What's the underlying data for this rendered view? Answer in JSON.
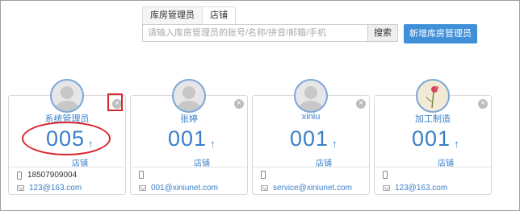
{
  "tabs": [
    {
      "label": "库房管理员",
      "active": false
    },
    {
      "label": "店铺",
      "active": true
    }
  ],
  "search": {
    "placeholder": "请输入库房管理员的账号/名称/拼音/邮箱/手机",
    "button_label": "搜索"
  },
  "add_button_label": "新增库房管理员",
  "cards": [
    {
      "name": "系统管理员",
      "count": "005",
      "arrow": "↑",
      "unit": "店铺",
      "phone": "18507909004",
      "email": "123@163.com",
      "avatar": "default-avatar-icon"
    },
    {
      "name": "张婷",
      "count": "001",
      "arrow": "↑",
      "unit": "店铺",
      "phone": "",
      "email": "001@xiniunet.com",
      "avatar": "default-avatar-icon"
    },
    {
      "name": "xiniu",
      "count": "001",
      "arrow": "↑",
      "unit": "店铺",
      "phone": "",
      "email": "service@xiniunet.com",
      "avatar": "default-avatar-icon"
    },
    {
      "name": "加工制造",
      "count": "001",
      "arrow": "↑",
      "unit": "店铺",
      "phone": "",
      "email": "123@163.com",
      "avatar": "flower-avatar-icon"
    }
  ],
  "close_icon": "×",
  "colors": {
    "accent": "#3a7fc6",
    "button": "#3f8fd9",
    "annotation": "#d9262c"
  }
}
